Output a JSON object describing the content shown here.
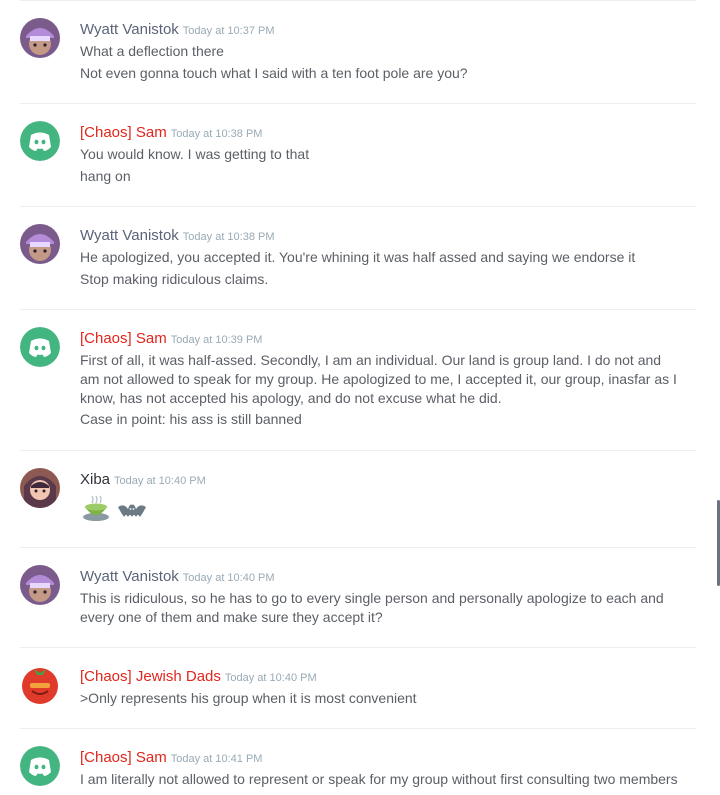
{
  "messages": [
    {
      "username": "Wyatt Vanistok",
      "timestamp": "Today at 10:37 PM",
      "avatar": "wyatt",
      "lines": [
        "What a deflection there",
        "Not even gonna touch what I said with a ten foot pole are you?"
      ]
    },
    {
      "username": "[Chaos] Sam",
      "timestamp": "Today at 10:38 PM",
      "avatar": "discord",
      "lines": [
        "You would know. I was getting to that",
        "hang on"
      ]
    },
    {
      "username": "Wyatt Vanistok",
      "timestamp": "Today at 10:38 PM",
      "avatar": "wyatt",
      "lines": [
        "He apologized, you accepted it. You're whining it was half assed and saying we endorse it",
        "Stop making ridiculous claims."
      ]
    },
    {
      "username": "[Chaos] Sam",
      "timestamp": "Today at 10:39 PM",
      "avatar": "discord",
      "lines": [
        "First of all, it was half-assed. Secondly, I am an individual. Our land is group land. I do not and am not allowed to speak for my group. He apologized to me, I accepted it, our group, inasfar as I know, has not accepted his apology, and do not excuse what he did.",
        "Case in point: his ass is still banned"
      ]
    },
    {
      "username": "Xiba",
      "timestamp": "Today at 10:40 PM",
      "avatar": "xiba",
      "emojis": [
        "tea-emoji",
        "bat-emoji"
      ]
    },
    {
      "username": "Wyatt Vanistok",
      "timestamp": "Today at 10:40 PM",
      "avatar": "wyatt",
      "lines": [
        "This is ridiculous, so he has to go to every single person and personally apologize to each and every one of them and make sure they accept it?"
      ]
    },
    {
      "username": "[Chaos] Jewish Dads",
      "timestamp": "Today at 10:40 PM",
      "avatar": "tomato",
      "lines": [
        ">Only represents his group when it is most convenient"
      ]
    },
    {
      "username": "[Chaos] Sam",
      "timestamp": "Today at 10:41 PM",
      "avatar": "discord",
      "lines": [
        "I am literally not allowed to represent or speak for my group without first consulting two members"
      ]
    }
  ],
  "colors": {
    "chaos_role": "#e0261d",
    "default_user": "#5b6478",
    "discord_avatar": "#43b581",
    "timestamp": "#99aab5"
  }
}
